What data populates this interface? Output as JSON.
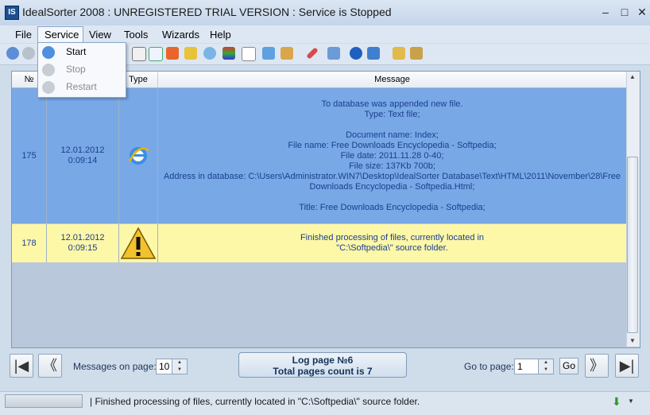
{
  "window": {
    "title": "IdealSorter 2008 :  UNREGISTERED TRIAL VERSION : Service is Stopped",
    "app_icon_text": "IS",
    "min_glyph": "–",
    "max_glyph": "□",
    "close_glyph": "✕"
  },
  "menubar": {
    "items": [
      "File",
      "Service",
      "View",
      "Tools",
      "Wizards",
      "Help"
    ],
    "active": "Service"
  },
  "service_menu": {
    "items": [
      {
        "label": "Start",
        "enabled": true
      },
      {
        "label": "Stop",
        "enabled": false
      },
      {
        "label": "Restart",
        "enabled": false
      }
    ]
  },
  "table": {
    "columns": [
      "№",
      "",
      "Type",
      "Message"
    ],
    "rows": [
      {
        "num": "175",
        "datetime": "12.01.2012\n0:09:14",
        "type_icon": "ie-icon",
        "message": "To database was appended new file.\nType: Text file;\n\nDocument name:  Index;\nFile name:  Free Downloads Encyclopedia - Softpedia;\nFile date:  2011.11.28 0-40;\nFile size:  137Kb 700b;\nAddress in database:  C:\\Users\\Administrator.WIN7\\Desktop\\IdealSorter Database\\Text\\HTML\\2011\\November\\28\\Free\nDownloads Encyclopedia - Softpedia.Html;\n\nTitle:  Free Downloads Encyclopedia - Softpedia;",
        "bg": "#78a8e6",
        "fg": "#1b3f8f"
      },
      {
        "num": "178",
        "datetime": "12.01.2012\n0:09:15",
        "type_icon": "warning-icon",
        "message": "Finished processing of files, currently located in\n\"C:\\Softpedia\\\" source folder.",
        "bg": "#fdf7a8",
        "fg": "#1b3f8f"
      }
    ]
  },
  "pager": {
    "first": "|◀",
    "prev": "《",
    "next": "》",
    "last": "▶|",
    "messages_label": "Messages on page:",
    "messages_value": "10",
    "log_page": "Log page №6",
    "total_pages": "Total pages count is 7",
    "goto_label": "Go to page:",
    "goto_value": "1",
    "go_button": "Go"
  },
  "status": {
    "text": "| Finished processing of files, currently located in  \"C:\\Softpedia\\\" source folder.",
    "arrow": "⬇"
  }
}
